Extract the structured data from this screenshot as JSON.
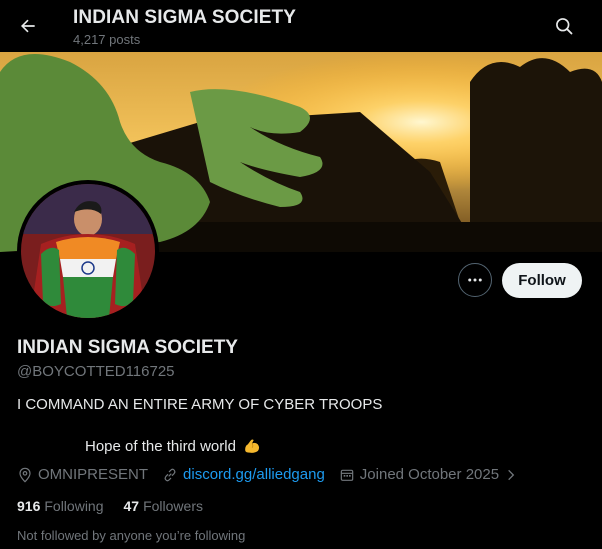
{
  "header": {
    "title": "INDIAN SIGMA SOCIETY",
    "posts_count": "4,217 posts",
    "back_icon": "arrow-left-icon",
    "search_icon": "search-icon"
  },
  "profile": {
    "display_name": "INDIAN SIGMA SOCIETY",
    "handle": "@BOYCOTTED116725",
    "bio_line1": "I COMMAND AN ENTIRE ARMY OF CYBER TROOPS",
    "bio_line2": "Hope of the third world",
    "bio_emoji": "flexed-biceps-icon",
    "location": "OMNIPRESENT",
    "website": "discord.gg/alliedgang",
    "joined": "Joined October 2025",
    "following_count": "916",
    "following_label": "Following",
    "followers_count": "47",
    "followers_label": "Followers",
    "followed_by_note": "Not followed by anyone you’re following"
  },
  "actions": {
    "follow_label": "Follow",
    "more_icon": "more-dots-icon"
  },
  "colors": {
    "background": "#000000",
    "text": "#e7e9ea",
    "muted": "#71767b",
    "link": "#1d9bf0",
    "follow_bg": "#eff3f4"
  }
}
